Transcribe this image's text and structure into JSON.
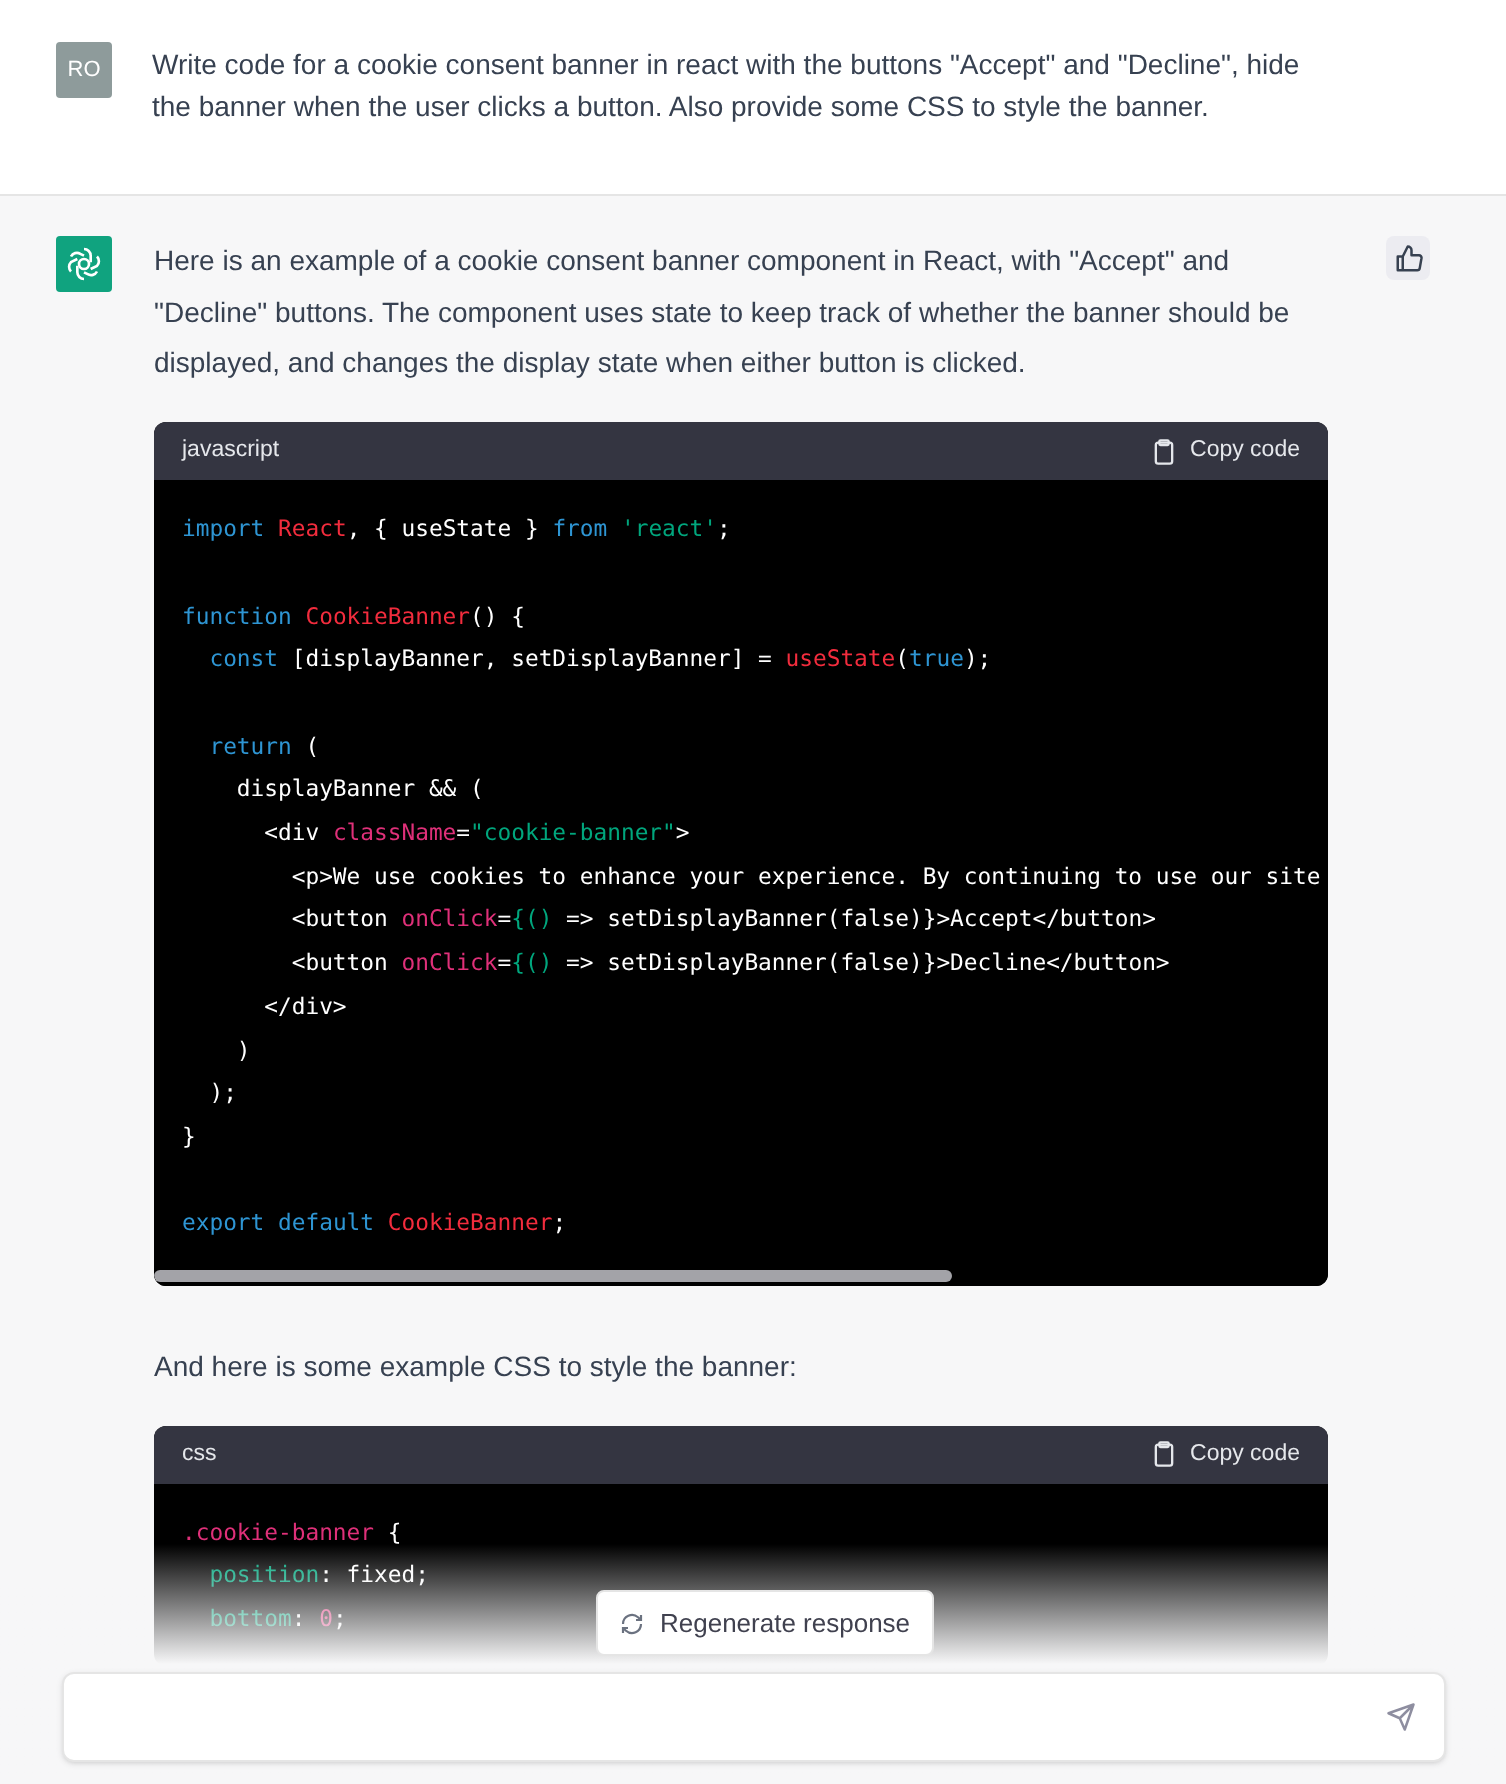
{
  "user_message": {
    "avatar": "RO",
    "text": "Write code for a cookie consent banner in react with the buttons \"Accept\" and \"Decline\", hide the banner when the user clicks a button. Also provide some CSS to style the banner."
  },
  "assistant_blocks": [
    {
      "kind": "text",
      "text": "Here is an example of a cookie consent banner component in React, with \"Accept\" and \"Decline\" buttons. The component uses state to keep track of whether the banner should be displayed, and changes the display state when either button is clicked."
    },
    {
      "kind": "code",
      "language": "javascript",
      "copy_label": "Copy code",
      "lines": [
        {
          "kind": "code",
          "tokens": [
            {
              "text": "import",
              "kind": "keyword"
            },
            {
              "text": " React",
              "kind": "function"
            },
            {
              "text": ", { useState } ",
              "kind": "plain"
            },
            {
              "text": "from",
              "kind": "keyword"
            },
            {
              "text": " 'react'",
              "kind": "string"
            },
            {
              "text": ";",
              "kind": "plain"
            }
          ]
        },
        {
          "kind": "blank"
        },
        {
          "kind": "code",
          "tokens": [
            {
              "text": "function",
              "kind": "keyword"
            },
            {
              "text": " CookieBanner",
              "kind": "function"
            },
            {
              "text": "() {",
              "kind": "plain"
            }
          ]
        },
        {
          "kind": "code",
          "tokens": [
            {
              "text": "  const",
              "kind": "keyword"
            },
            {
              "text": " [displayBanner, setDisplayBanner] = ",
              "kind": "plain"
            },
            {
              "text": "useState",
              "kind": "function"
            },
            {
              "text": "(",
              "kind": "plain"
            },
            {
              "text": "true",
              "kind": "keyword"
            },
            {
              "text": ");",
              "kind": "plain"
            }
          ]
        },
        {
          "kind": "blank"
        },
        {
          "kind": "code",
          "tokens": [
            {
              "text": "  return",
              "kind": "keyword"
            },
            {
              "text": " (",
              "kind": "plain"
            }
          ]
        },
        {
          "kind": "code",
          "tokens": [
            {
              "text": "    displayBanner && (",
              "kind": "plain"
            }
          ]
        },
        {
          "kind": "code",
          "tokens": [
            {
              "text": "      <div ",
              "kind": "plain"
            },
            {
              "text": "className",
              "kind": "attribute"
            },
            {
              "text": "=",
              "kind": "plain"
            },
            {
              "text": "\"cookie-banner\"",
              "kind": "string"
            },
            {
              "text": ">",
              "kind": "plain"
            }
          ]
        },
        {
          "kind": "code",
          "tokens": [
            {
              "text": "        <p>We use cookies to enhance your experience. By continuing to use our site",
              "kind": "plain"
            }
          ]
        },
        {
          "kind": "code",
          "tokens": [
            {
              "text": "        <button ",
              "kind": "plain"
            },
            {
              "text": "onClick",
              "kind": "attribute"
            },
            {
              "text": "=",
              "kind": "plain"
            },
            {
              "text": "{()",
              "kind": "string"
            },
            {
              "text": " => setDisplayBanner(false)}>Accept</button>",
              "kind": "plain"
            }
          ]
        },
        {
          "kind": "code",
          "tokens": [
            {
              "text": "        <button ",
              "kind": "plain"
            },
            {
              "text": "onClick",
              "kind": "attribute"
            },
            {
              "text": "=",
              "kind": "plain"
            },
            {
              "text": "{()",
              "kind": "string"
            },
            {
              "text": " => setDisplayBanner(false)}>Decline</button>",
              "kind": "plain"
            }
          ]
        },
        {
          "kind": "code",
          "tokens": [
            {
              "text": "      </div>",
              "kind": "plain"
            }
          ]
        },
        {
          "kind": "code",
          "tokens": [
            {
              "text": "    )",
              "kind": "plain"
            }
          ]
        },
        {
          "kind": "code",
          "tokens": [
            {
              "text": "  );",
              "kind": "plain"
            }
          ]
        },
        {
          "kind": "code",
          "tokens": [
            {
              "text": "}",
              "kind": "plain"
            }
          ]
        },
        {
          "kind": "blank"
        },
        {
          "kind": "code",
          "tokens": [
            {
              "text": "export",
              "kind": "keyword"
            },
            {
              "text": " default",
              "kind": "keyword"
            },
            {
              "text": " CookieBanner",
              "kind": "function"
            },
            {
              "text": ";",
              "kind": "plain"
            }
          ]
        }
      ],
      "scrollbar": true
    },
    {
      "kind": "text",
      "text": "And here is some example CSS to style the banner:"
    },
    {
      "kind": "code",
      "language": "css",
      "copy_label": "Copy code",
      "lines": [
        {
          "kind": "code",
          "tokens": [
            {
              "text": ".cookie-banner",
              "kind": "attribute"
            },
            {
              "text": " {",
              "kind": "plain"
            }
          ]
        },
        {
          "kind": "code",
          "tokens": [
            {
              "text": "  position",
              "kind": "string"
            },
            {
              "text": ": fixed;",
              "kind": "plain"
            }
          ]
        },
        {
          "kind": "code",
          "tokens": [
            {
              "text": "  bottom",
              "kind": "string"
            },
            {
              "text": ": ",
              "kind": "plain"
            },
            {
              "text": "0",
              "kind": "attribute"
            },
            {
              "text": ";",
              "kind": "plain"
            }
          ]
        }
      ]
    }
  ],
  "regenerate_button": {
    "label": "Regenerate response"
  }
}
